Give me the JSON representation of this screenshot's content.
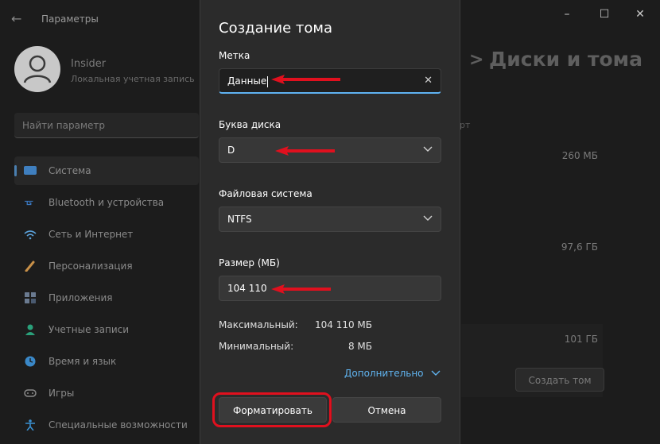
{
  "window": {
    "app_title": "Параметры",
    "back_icon": "back-arrow-icon",
    "controls": [
      "minimize-icon",
      "maximize-icon",
      "close-icon"
    ]
  },
  "user": {
    "name": "Insider",
    "account_type": "Локальная учетная запись"
  },
  "search": {
    "placeholder": "Найти параметр"
  },
  "nav": {
    "items": [
      {
        "label": "Система",
        "icon": "display-icon",
        "color": "#4a8fd4"
      },
      {
        "label": "Bluetooth и устройства",
        "icon": "bluetooth-icon",
        "color": "#3a78c0"
      },
      {
        "label": "Сеть и Интернет",
        "icon": "wifi-icon",
        "color": "#5aa0d8"
      },
      {
        "label": "Персонализация",
        "icon": "brush-icon",
        "color": "#c89048"
      },
      {
        "label": "Приложения",
        "icon": "apps-icon",
        "color": "#6a7a90"
      },
      {
        "label": "Учетные записи",
        "icon": "person-icon",
        "color": "#2aa07a"
      },
      {
        "label": "Время и язык",
        "icon": "globe-clock-icon",
        "color": "#3a88c8"
      },
      {
        "label": "Игры",
        "icon": "gamepad-icon",
        "color": "#8a8a8a"
      },
      {
        "label": "Специальные возможности",
        "icon": "accessibility-icon",
        "color": "#3a90d0"
      }
    ]
  },
  "page": {
    "heading": "Диски и тома",
    "heading_chevron": ">",
    "partial_text": "рт",
    "sizes": [
      "260 МБ",
      "97,6 ГБ",
      "101 ГБ"
    ],
    "create_volume_button": "Создать том"
  },
  "dialog": {
    "title": "Создание тома",
    "label_field": {
      "label": "Метка",
      "value": "Данные"
    },
    "drive_letter": {
      "label": "Буква диска",
      "value": "D"
    },
    "file_system": {
      "label": "Файловая система",
      "value": "NTFS"
    },
    "size": {
      "label": "Размер (МБ)",
      "value": "104 110"
    },
    "max": {
      "label": "Максимальный:",
      "value": "104 110 МБ"
    },
    "min": {
      "label": "Минимальный:",
      "value": "8 МБ"
    },
    "advanced": "Дополнительно",
    "format_button": "Форматировать",
    "cancel_button": "Отмена"
  },
  "colors": {
    "accent": "#5fb2f2",
    "annotation_red": "#e0101e"
  }
}
